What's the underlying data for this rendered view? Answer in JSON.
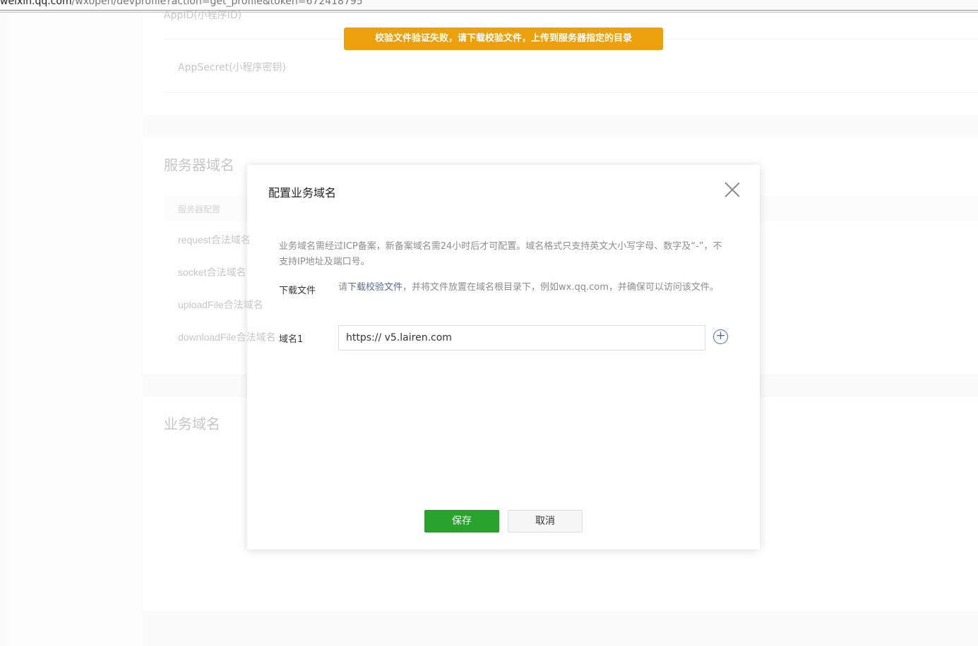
{
  "browser": {
    "url_host": "weixin.qq.com",
    "url_path": "/wxopen/devprofile?action=get_profile&token=672418795"
  },
  "toast": {
    "message": "校验文件验证失败，请下载校验文件，上传到服务器指定的目录"
  },
  "background": {
    "appid_label": "AppID(小程序ID)",
    "appsecret_label": "AppSecret(小程序密钥)",
    "server_domain_title": "服务器域名",
    "server_config_header": "服务器配置",
    "rows": [
      "request合法域名",
      "socket合法域名",
      "uploadFile合法域名",
      "downloadFile合法域名"
    ],
    "business_domain_title": "业务域名"
  },
  "dialog": {
    "title": "配置业务域名",
    "description": "业务域名需经过ICP备案，新备案域名需24小时后才可配置。域名格式只支持英文大小写字母、数字及“-”，不支持IP地址及端口号。",
    "download_label": "下载文件",
    "download_prefix": "请",
    "download_link": "下载校验文件",
    "download_suffix": "，并将文件放置在域名根目录下，例如wx.qq.com，并确保可以访问该文件。",
    "domain_label": "域名1",
    "domain_value": "https:// v5.lairen.com",
    "save": "保存",
    "cancel": "取消"
  }
}
